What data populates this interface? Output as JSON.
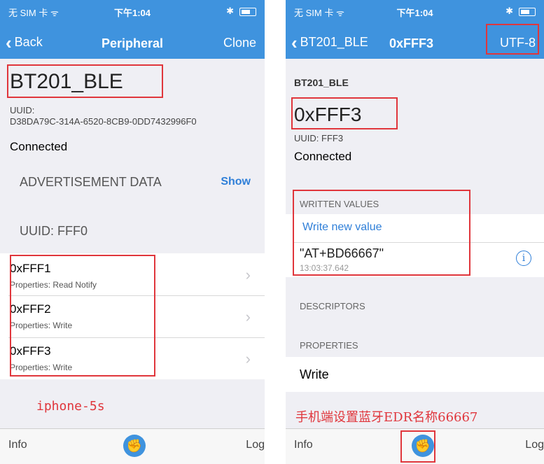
{
  "left": {
    "status": {
      "carrier": "无 SIM 卡 ᯤ",
      "time": "下午1:04",
      "bluetooth": "✱"
    },
    "nav": {
      "back_label": "Back",
      "title": "Peripheral",
      "action": "Clone"
    },
    "device_name": "BT201_BLE",
    "uuid_label": "UUID:",
    "uuid_value": "D38DA79C-314A-6520-8CB9-0DD7432996F0",
    "connection_status": "Connected",
    "ad_header": "ADVERTISEMENT DATA",
    "ad_show": "Show",
    "service_uuid": "UUID: FFF0",
    "characteristics": [
      {
        "name": "0xFFF1",
        "props": "Properties: Read Notify"
      },
      {
        "name": "0xFFF2",
        "props": "Properties: Write"
      },
      {
        "name": "0xFFF3",
        "props": "Properties: Write"
      }
    ],
    "annotation": "iphone-5s",
    "tabs": {
      "info": "Info",
      "log": "Log"
    }
  },
  "right": {
    "status": {
      "carrier": "无 SIM 卡 ᯤ",
      "time": "下午1:04",
      "bluetooth": "✱"
    },
    "nav": {
      "back_label": "BT201_BLE",
      "title": "0xFFF3",
      "action": "UTF-8"
    },
    "device_name": "BT201_BLE",
    "char_name": "0xFFF3",
    "uuid": "UUID: FFF3",
    "connection_status": "Connected",
    "written_header": "WRITTEN VALUES",
    "write_new": "Write new value",
    "written_value": "\"AT+BD66667\"",
    "written_time": "13:03:37.642",
    "info_icon": "i",
    "descriptors_header": "DESCRIPTORS",
    "properties_header": "PROPERTIES",
    "property_value": "Write",
    "annotation": "手机端设置蓝牙EDR名称66667",
    "tabs": {
      "info": "Info",
      "log": "Log"
    }
  },
  "colors": {
    "nav": "#3f93de",
    "highlight": "#e0363c",
    "link": "#2f7fd8"
  }
}
